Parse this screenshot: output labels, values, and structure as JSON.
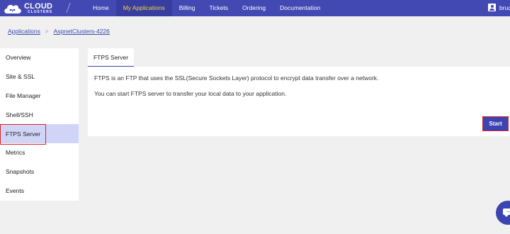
{
  "topbar": {
    "logo": {
      "line1": "CLOUD",
      "line2": "CLUSTERS"
    },
    "nav": [
      {
        "label": "Home",
        "active": false
      },
      {
        "label": "My Applications",
        "active": true
      },
      {
        "label": "Billing",
        "active": false
      },
      {
        "label": "Tickets",
        "active": false
      },
      {
        "label": "Ordering",
        "active": false
      },
      {
        "label": "Documentation",
        "active": false
      }
    ],
    "user": {
      "name": "bruc"
    }
  },
  "breadcrumb": {
    "items": [
      "Applications",
      "AspnetClusters-4226"
    ],
    "separator": ">"
  },
  "sidebar": {
    "items": [
      {
        "label": "Overview",
        "active": false
      },
      {
        "label": "Site & SSL",
        "active": false
      },
      {
        "label": "File Manager",
        "active": false
      },
      {
        "label": "Shell/SSH",
        "active": false
      },
      {
        "label": "FTPS Server",
        "active": true
      },
      {
        "label": "Metrics",
        "active": false
      },
      {
        "label": "Snapshots",
        "active": false
      },
      {
        "label": "Events",
        "active": false
      }
    ]
  },
  "main": {
    "tab_label": "FTPS Server",
    "description": "FTPS is an FTP that uses the SSL(Secure Sockets Layer) protocol to encrypt data transfer over a network.",
    "instruction": "You can start FTPS server to transfer your local data to your application.",
    "start_label": "Start"
  },
  "chat": {
    "glyph": "..."
  },
  "colors": {
    "brand": "#4349b3",
    "nav_active_text": "#f2d24a",
    "sidebar_active_bg": "#d0d5f7",
    "highlight": "#d8262d",
    "button": "#3c44b1"
  },
  "icons": [
    "cloud-logo-icon",
    "user-icon",
    "chat-icon"
  ]
}
